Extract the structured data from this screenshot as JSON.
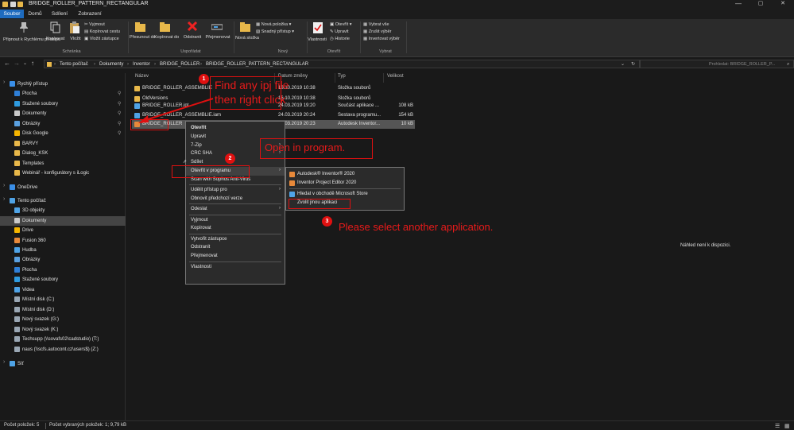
{
  "window": {
    "title": "BRIDGE_ROLLER_PATTERN_RECTANGULAR",
    "minimize": "—",
    "maximize": "▢",
    "close": "✕"
  },
  "ribbon_tabs": [
    "Soubor",
    "Domů",
    "Sdílení",
    "Zobrazení"
  ],
  "ribbon": {
    "pin_label": "Připnout k Rychlému přístupu",
    "copy_label": "Kopírovat",
    "paste_label": "Vložit",
    "cut_label": "Vyjmout",
    "copy_path_label": "Kopírovat cestu",
    "paste_shortcut_label": "Vložit zástupce",
    "clipboard_group": "Schránka",
    "move_to_label": "Přesunout do",
    "copy_to_label": "Kopírovat do",
    "delete_label": "Odstranit",
    "rename_label": "Přejmenovat",
    "organize_group": "Uspořádat",
    "new_folder_label": "Nová složka",
    "new_item_label": "Nová položka",
    "easy_access_label": "Snadný přístup",
    "new_group": "Nový",
    "properties_label": "Vlastnosti",
    "open_label": "Otevřít",
    "edit_label": "Upravit",
    "history_label": "Historie",
    "open_group": "Otevřít",
    "select_all_label": "Vybrat vše",
    "select_none_label": "Zrušit výběr",
    "invert_selection_label": "Invertovat výběr",
    "select_group": "Vybrat"
  },
  "address": {
    "crumbs": [
      "Tento počítač",
      "Dokumenty",
      "Inventor",
      "BRIDGE_ROLLER",
      "BRIDGE_ROLLER_PATTERN_RECTANGULAR"
    ],
    "search_placeholder": "Prohledat: BRIDGE_ROLLER_P..."
  },
  "nav": {
    "items": [
      {
        "label": "Rychlý přístup",
        "icon": "star-icon",
        "color": "#3a8ee6",
        "indent": 0,
        "pinned": false,
        "selected": false
      },
      {
        "label": "Plocha",
        "icon": "desktop-icon",
        "color": "#2f7fd6",
        "indent": 1,
        "pinned": true,
        "selected": false
      },
      {
        "label": "Stažené soubory",
        "icon": "download-icon",
        "color": "#2f9be0",
        "indent": 1,
        "pinned": true,
        "selected": false
      },
      {
        "label": "Dokumenty",
        "icon": "documents-icon",
        "color": "#c9c9c9",
        "indent": 1,
        "pinned": true,
        "selected": false
      },
      {
        "label": "Obrázky",
        "icon": "pictures-icon",
        "color": "#5aa0e0",
        "indent": 1,
        "pinned": true,
        "selected": false
      },
      {
        "label": "Disk Google",
        "icon": "google-drive-icon",
        "color": "#f4b400",
        "indent": 1,
        "pinned": true,
        "selected": false
      },
      {
        "label": "BARVY",
        "icon": "folder-icon",
        "color": "#e8b84a",
        "indent": 1,
        "pinned": false,
        "selected": false
      },
      {
        "label": "Dialog_KSK",
        "icon": "folder-icon",
        "color": "#e8b84a",
        "indent": 1,
        "pinned": false,
        "selected": false
      },
      {
        "label": "Templates",
        "icon": "folder-icon",
        "color": "#e8b84a",
        "indent": 1,
        "pinned": false,
        "selected": false
      },
      {
        "label": "Webinář - konfigurátory s iLogic",
        "icon": "folder-icon",
        "color": "#e8b84a",
        "indent": 1,
        "pinned": false,
        "selected": false
      },
      {
        "label": "OneDrive",
        "icon": "cloud-icon",
        "color": "#3a8ee6",
        "indent": 0,
        "pinned": false,
        "selected": false
      },
      {
        "label": "Tento počítač",
        "icon": "computer-icon",
        "color": "#4fa3e6",
        "indent": 0,
        "pinned": false,
        "selected": false
      },
      {
        "label": "3D objekty",
        "icon": "3d-objects-icon",
        "color": "#4fa3e6",
        "indent": 1,
        "pinned": false,
        "selected": false
      },
      {
        "label": "Dokumenty",
        "icon": "documents-icon",
        "color": "#c9c9c9",
        "indent": 1,
        "pinned": false,
        "selected": true
      },
      {
        "label": "Drive",
        "icon": "google-drive-icon",
        "color": "#f4b400",
        "indent": 1,
        "pinned": false,
        "selected": false
      },
      {
        "label": "Fusion 360",
        "icon": "fusion-icon",
        "color": "#e8893a",
        "indent": 1,
        "pinned": false,
        "selected": false
      },
      {
        "label": "Hudba",
        "icon": "music-icon",
        "color": "#4fa3e6",
        "indent": 1,
        "pinned": false,
        "selected": false
      },
      {
        "label": "Obrázky",
        "icon": "pictures-icon",
        "color": "#5aa0e0",
        "indent": 1,
        "pinned": false,
        "selected": false
      },
      {
        "label": "Plocha",
        "icon": "desktop-icon",
        "color": "#2f7fd6",
        "indent": 1,
        "pinned": false,
        "selected": false
      },
      {
        "label": "Stažené soubory",
        "icon": "download-icon",
        "color": "#2f9be0",
        "indent": 1,
        "pinned": false,
        "selected": false
      },
      {
        "label": "Videa",
        "icon": "video-icon",
        "color": "#4fa3e6",
        "indent": 1,
        "pinned": false,
        "selected": false
      },
      {
        "label": "Místní disk (C:)",
        "icon": "disk-icon",
        "color": "#9aa7b4",
        "indent": 1,
        "pinned": false,
        "selected": false
      },
      {
        "label": "Místní disk (D:)",
        "icon": "disk-icon",
        "color": "#9aa7b4",
        "indent": 1,
        "pinned": false,
        "selected": false
      },
      {
        "label": "Nový svazek (G:)",
        "icon": "disk-icon",
        "color": "#9aa7b4",
        "indent": 1,
        "pinned": false,
        "selected": false
      },
      {
        "label": "Nový svazek (K:)",
        "icon": "disk-icon",
        "color": "#9aa7b4",
        "indent": 1,
        "pinned": false,
        "selected": false
      },
      {
        "label": "Techsupp (\\\\sovafs02\\cadstudio) (T:)",
        "icon": "network-drive-icon",
        "color": "#9aa7b4",
        "indent": 1,
        "pinned": false,
        "selected": false
      },
      {
        "label": "naus (\\\\scfs.autocont.cz\\users$) (Z:)",
        "icon": "network-drive-icon",
        "color": "#9aa7b4",
        "indent": 1,
        "pinned": false,
        "selected": false
      },
      {
        "label": "Síť",
        "icon": "network-icon",
        "color": "#4fa3e6",
        "indent": 0,
        "pinned": false,
        "selected": false
      }
    ]
  },
  "file_list": {
    "columns": [
      "Název",
      "Datum změny",
      "Typ",
      "Velikost"
    ],
    "rows": [
      {
        "name": "BRIDGE_ROLLER_ASSEMBLIE",
        "date": "16.10.2019 10:38",
        "type": "Složka souborů",
        "size": "",
        "icon": "folder-icon",
        "color": "#e8b84a"
      },
      {
        "name": "OldVersions",
        "date": "16.10.2019 10:38",
        "type": "Složka souborů",
        "size": "",
        "icon": "folder-icon",
        "color": "#e8b84a"
      },
      {
        "name": "BRIDGE_ROLLER.ipt",
        "date": "24.03.2019 19:20",
        "type": "Součást aplikace ...",
        "size": "108 kB",
        "icon": "inventor-part-icon",
        "color": "#4fa3e6"
      },
      {
        "name": "BRIDGE_ROLLER_ASSEMBLIE.iam",
        "date": "24.03.2019 20:24",
        "type": "Sestava programu...",
        "size": "154 kB",
        "icon": "inventor-assembly-icon",
        "color": "#4fa3e6"
      },
      {
        "name": "BRIDGE_ROLLER",
        "date": "24.03.2019 20:23",
        "type": "Autodesk Inventor...",
        "size": "10 kB",
        "icon": "inventor-ipj-icon",
        "color": "#e8893a"
      }
    ]
  },
  "context_menu": {
    "items": [
      {
        "label": "Otevřít",
        "bold": true,
        "arrow": false,
        "sep_after": false,
        "icon": ""
      },
      {
        "label": "Upravit",
        "bold": false,
        "arrow": false,
        "sep_after": false,
        "icon": ""
      },
      {
        "label": "7-Zip",
        "bold": false,
        "arrow": true,
        "sep_after": false,
        "icon": ""
      },
      {
        "label": "CRC SHA",
        "bold": false,
        "arrow": true,
        "sep_after": false,
        "icon": ""
      },
      {
        "label": "Sdílet",
        "bold": false,
        "arrow": false,
        "sep_after": false,
        "icon": "share-icon"
      },
      {
        "label": "Otevřít v programu",
        "bold": false,
        "arrow": true,
        "sep_after": false,
        "icon": "",
        "highlighted": true
      },
      {
        "label": "Scan with Sophos Anti-Virus",
        "bold": false,
        "arrow": false,
        "sep_after": true,
        "icon": ""
      },
      {
        "label": "Udělit přístup pro",
        "bold": false,
        "arrow": true,
        "sep_after": false,
        "icon": ""
      },
      {
        "label": "Obnovit předchozí verze",
        "bold": false,
        "arrow": false,
        "sep_after": true,
        "icon": ""
      },
      {
        "label": "Odeslat",
        "bold": false,
        "arrow": true,
        "sep_after": true,
        "icon": ""
      },
      {
        "label": "Vyjmout",
        "bold": false,
        "arrow": false,
        "sep_after": false,
        "icon": ""
      },
      {
        "label": "Kopírovat",
        "bold": false,
        "arrow": false,
        "sep_after": true,
        "icon": ""
      },
      {
        "label": "Vytvořit zástupce",
        "bold": false,
        "arrow": false,
        "sep_after": false,
        "icon": ""
      },
      {
        "label": "Odstranit",
        "bold": false,
        "arrow": false,
        "sep_after": false,
        "icon": ""
      },
      {
        "label": "Přejmenovat",
        "bold": false,
        "arrow": false,
        "sep_after": true,
        "icon": ""
      },
      {
        "label": "Vlastnosti",
        "bold": false,
        "arrow": false,
        "sep_after": false,
        "icon": ""
      }
    ]
  },
  "open_with_menu": {
    "items": [
      {
        "label": "Autodesk® Inventor® 2020",
        "icon": "inventor-app-icon",
        "color": "#e8893a",
        "sep_after": false
      },
      {
        "label": "Inventor Project Editor 2020",
        "icon": "project-editor-icon",
        "color": "#e8893a",
        "sep_after": true
      },
      {
        "label": "Hledat v obchodě Microsoft Store",
        "icon": "store-icon",
        "color": "#4fa3e6",
        "sep_after": false
      },
      {
        "label": "Zvolit jinou aplikaci",
        "icon": "",
        "color": "",
        "sep_after": false
      }
    ]
  },
  "annotations": {
    "step1_number": "1",
    "step1_text_line1": "Find any ipj file",
    "step1_text_line2": "then right click",
    "step2_number": "2",
    "step2_text": "Open in program.",
    "step3_number": "3",
    "step3_text": "Please select another application.",
    "color": "#e01010"
  },
  "preview": {
    "text": "Náhled není k dispozici."
  },
  "status": {
    "item_count": "Počet položek: 5",
    "selected": "Počet vybraných položek: 1; 9,79 kB"
  }
}
